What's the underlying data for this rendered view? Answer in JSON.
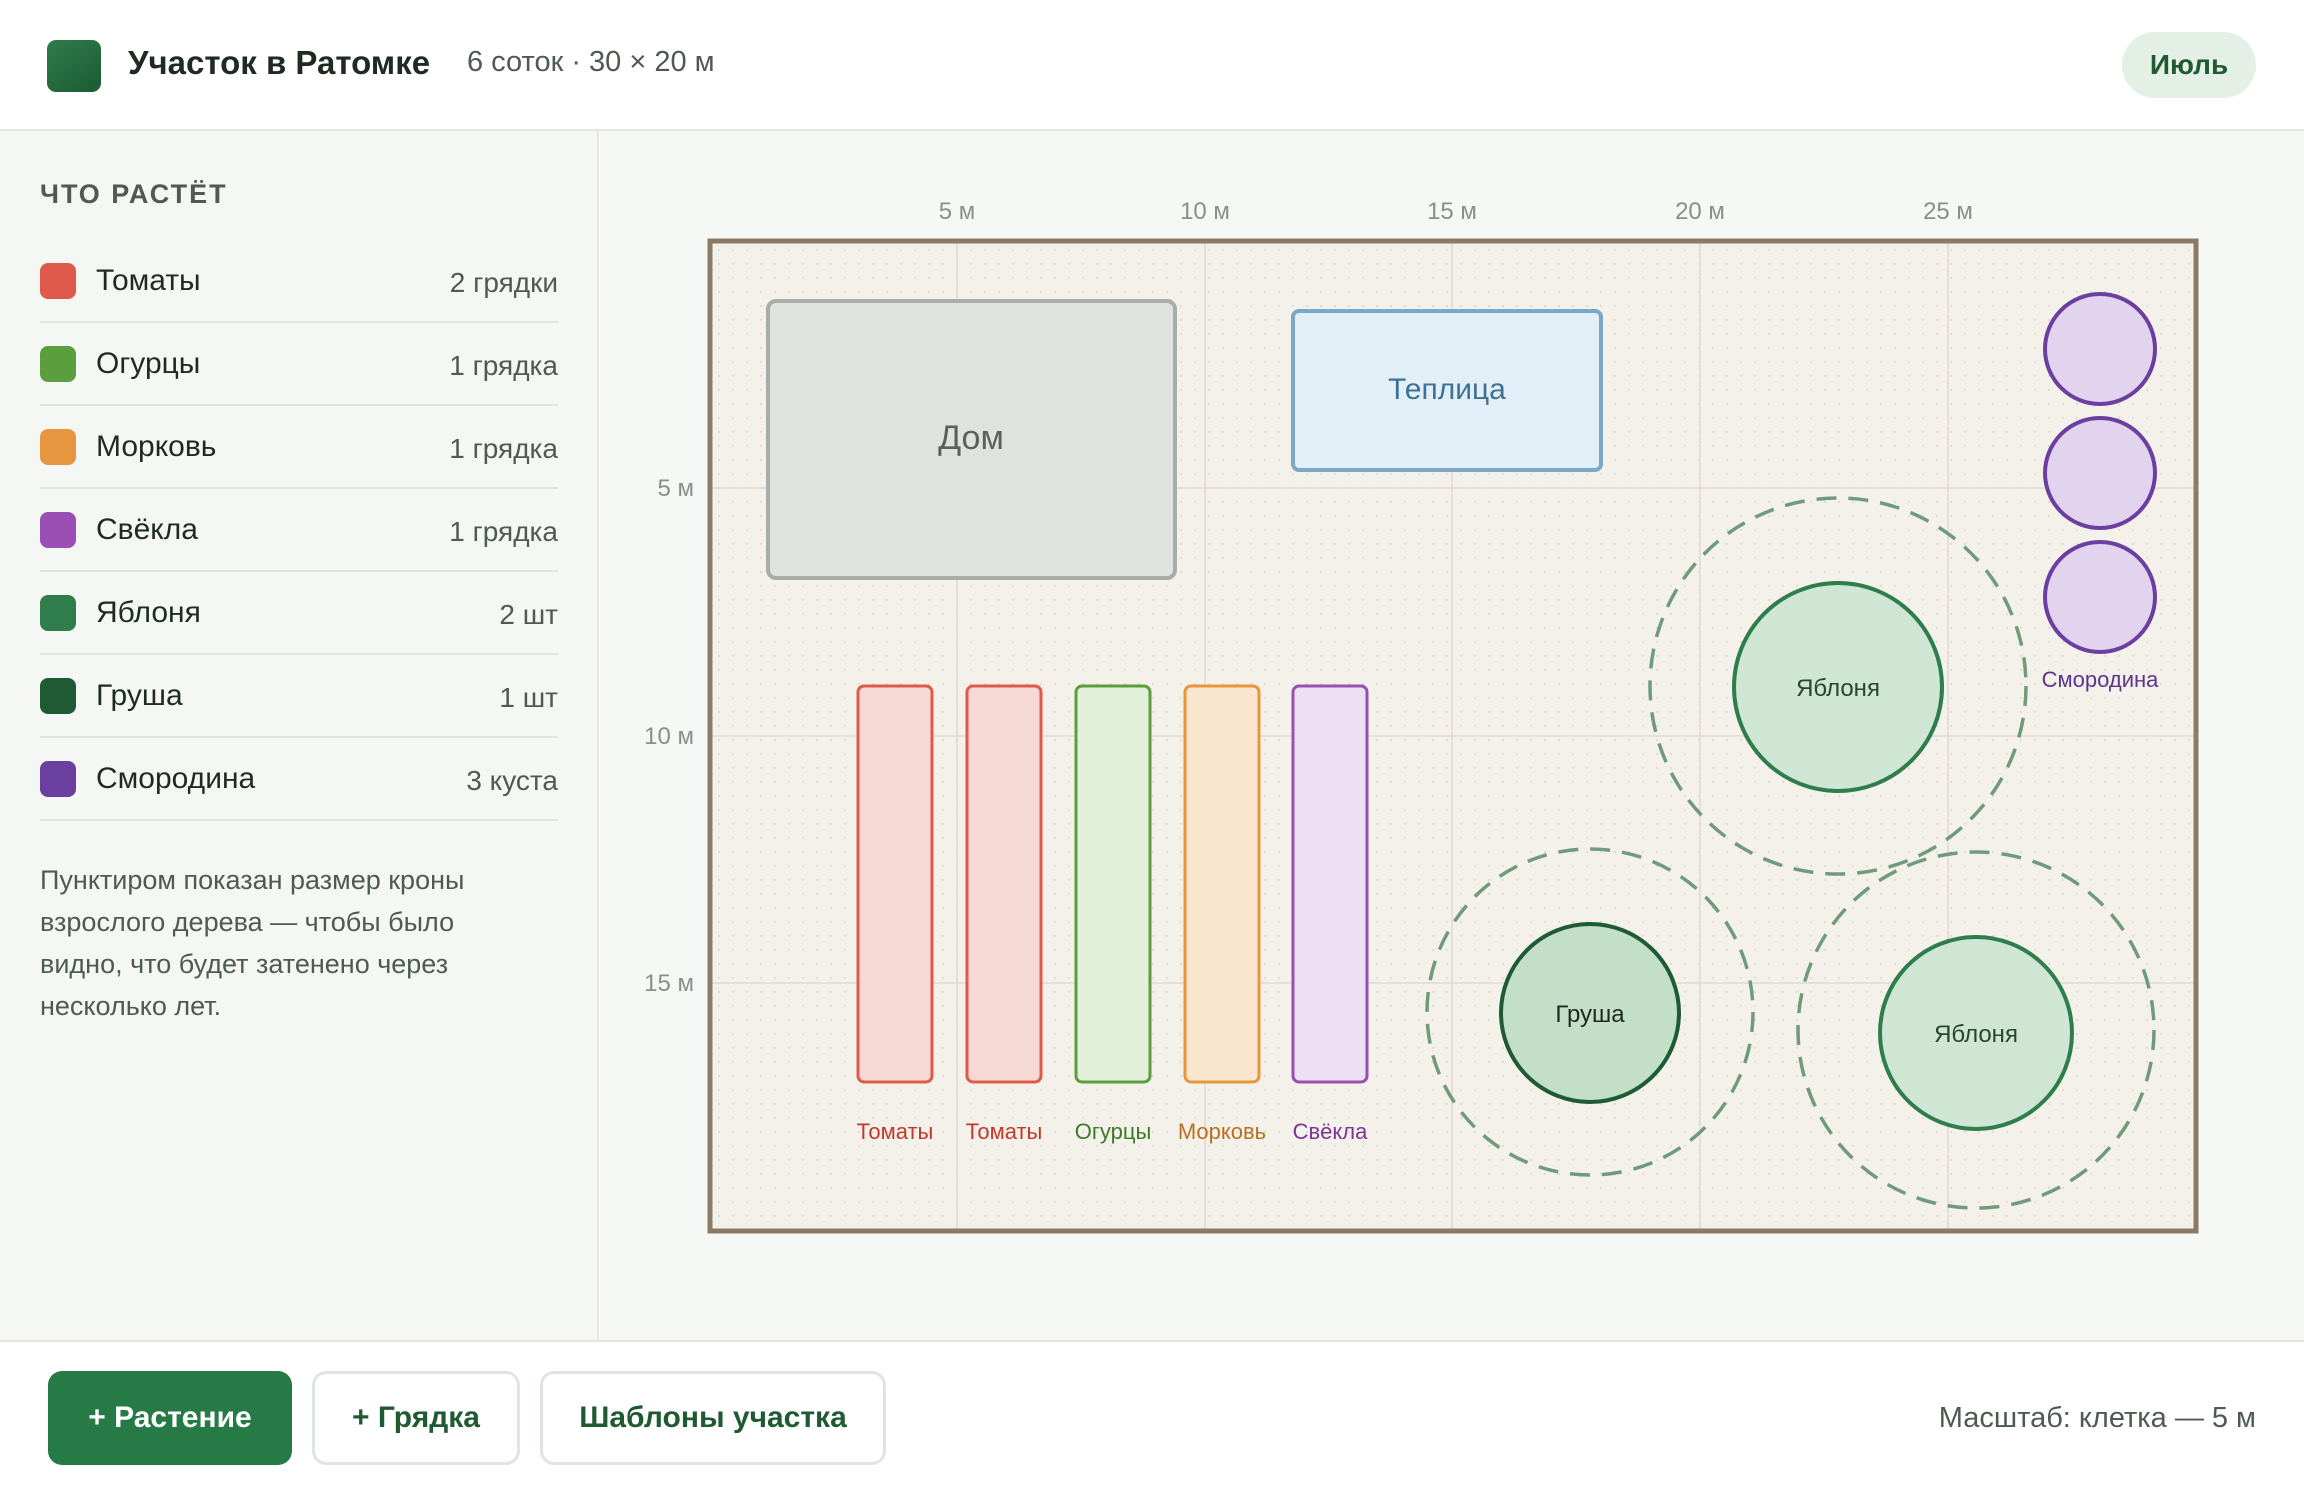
{
  "header": {
    "title": "Участок в Ратомке",
    "subtitle": "6 соток · 30 × 20 м",
    "month": "Июль"
  },
  "sidebar": {
    "title": "ЧТО РАСТЁТ",
    "items": [
      {
        "name": "Томаты",
        "count": "2 грядки",
        "color": "#e05a4c"
      },
      {
        "name": "Огурцы",
        "count": "1 грядка",
        "color": "#5a9e3e"
      },
      {
        "name": "Морковь",
        "count": "1 грядка",
        "color": "#e5963f"
      },
      {
        "name": "Свёкла",
        "count": "1 грядка",
        "color": "#9a4fb5"
      },
      {
        "name": "Яблоня",
        "count": "2 шт",
        "color": "#2e7d4a"
      },
      {
        "name": "Груша",
        "count": "1 шт",
        "color": "#1e5a34"
      },
      {
        "name": "Смородина",
        "count": "3 куста",
        "color": "#6a3fa0"
      }
    ],
    "note": "Пунктиром показан размер кроны взрослого дерева — чтобы было видно, что будет затенено через несколько лет."
  },
  "plan": {
    "width_m": 30,
    "height_m": 20,
    "grid_step_m": 5,
    "x_ticks": [
      "5 м",
      "10 м",
      "15 м",
      "20 м",
      "25 м"
    ],
    "y_ticks": [
      "5 м",
      "10 м",
      "15 м"
    ],
    "house": {
      "label": "Дом"
    },
    "greenhouse": {
      "label": "Теплица"
    },
    "beds": [
      {
        "label": "Томаты",
        "stroke": "#e05a4c",
        "fill": "#f6d8d5",
        "text": "#c0392b"
      },
      {
        "label": "Томаты",
        "stroke": "#e05a4c",
        "fill": "#f6d8d5",
        "text": "#c0392b"
      },
      {
        "label": "Огурцы",
        "stroke": "#5a9e3e",
        "fill": "#e2f0d9",
        "text": "#3f7a2a"
      },
      {
        "label": "Морковь",
        "stroke": "#e5963f",
        "fill": "#fae5cf",
        "text": "#b8701f"
      },
      {
        "label": "Свёкла",
        "stroke": "#9a4fb5",
        "fill": "#ecdff3",
        "text": "#7a3596"
      }
    ],
    "trees": [
      {
        "label": "Яблоня",
        "kind": "apple"
      },
      {
        "label": "Груша",
        "kind": "pear"
      },
      {
        "label": "Яблоня",
        "kind": "apple"
      }
    ],
    "currant": {
      "label": "Смородина",
      "count": 3
    }
  },
  "footer": {
    "add_plant": "+ Растение",
    "add_bed": "+ Грядка",
    "templates": "Шаблоны участка",
    "scale": "Масштаб: клетка — 5 м"
  }
}
